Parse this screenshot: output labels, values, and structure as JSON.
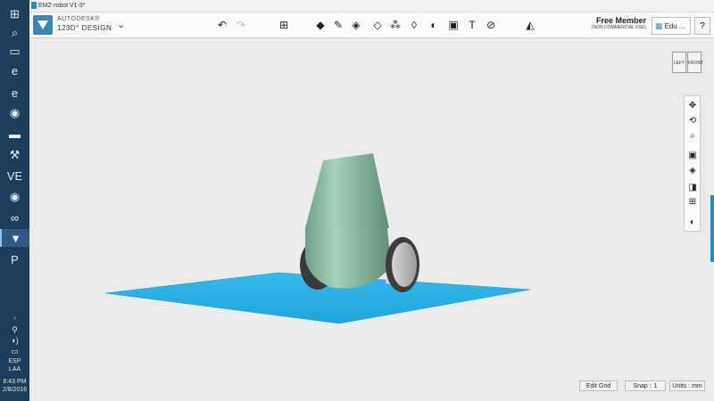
{
  "taskbar": {
    "items": [
      {
        "name": "windows-start-icon",
        "glyph": "⊞"
      },
      {
        "name": "search-icon",
        "glyph": "⌕"
      },
      {
        "name": "task-view-icon",
        "glyph": "▭"
      },
      {
        "name": "edge-icon",
        "glyph": "e"
      },
      {
        "name": "ie-icon",
        "glyph": "e"
      },
      {
        "name": "chrome-icon",
        "glyph": "◉"
      },
      {
        "name": "file-explorer-icon",
        "glyph": "▬"
      },
      {
        "name": "app-icon",
        "glyph": "⚒"
      },
      {
        "name": "ve-app-icon",
        "glyph": "VE"
      },
      {
        "name": "chrome-alt-icon",
        "glyph": "◉"
      },
      {
        "name": "visual-studio-icon",
        "glyph": "∞"
      },
      {
        "name": "123d-design-icon",
        "glyph": "▼"
      },
      {
        "name": "powerpoint-icon",
        "glyph": "P"
      }
    ],
    "tray": {
      "chevron": "›",
      "lang1": "ESP",
      "lang2": "LAA",
      "time": "8:43 PM",
      "date": "2/8/2016"
    }
  },
  "window": {
    "title": "EMZ-robot V1-3*"
  },
  "app": {
    "brand_top": "AUTODESK®",
    "brand_name": "123D° DESIGN",
    "menu_arrow": "⌄",
    "undo": "↶",
    "redo": "↷",
    "tools": [
      {
        "name": "transform-tool-icon",
        "glyph": "⊞"
      },
      {
        "name": "primitives-tool-icon",
        "glyph": "◆"
      },
      {
        "name": "sketch-tool-icon",
        "glyph": "✎"
      },
      {
        "name": "construct-tool-icon",
        "glyph": "◈"
      },
      {
        "name": "modify-tool-icon",
        "glyph": "◇"
      },
      {
        "name": "pattern-tool-icon",
        "glyph": "⁂"
      },
      {
        "name": "grouping-tool-icon",
        "glyph": "◊"
      },
      {
        "name": "combine-tool-icon",
        "glyph": "◐"
      },
      {
        "name": "snap-tool-icon",
        "glyph": "▣"
      },
      {
        "name": "text-tool-icon",
        "glyph": "T"
      },
      {
        "name": "measure-tool-icon",
        "glyph": "⊘"
      },
      {
        "name": "material-tool-icon",
        "glyph": "◭"
      }
    ],
    "member_title": "Free Member",
    "member_sub": "(NON COMMERCIAL USE)",
    "account_label": "Edu ...",
    "help_label": "?"
  },
  "viewcube": {
    "left": "LEFT",
    "front": "FRONT"
  },
  "nav_tools": [
    {
      "name": "pan-icon",
      "glyph": "✥"
    },
    {
      "name": "orbit-icon",
      "glyph": "⟲"
    },
    {
      "name": "zoom-icon",
      "glyph": "⌕"
    },
    {
      "name": "fit-view-icon",
      "glyph": "▣"
    },
    {
      "name": "view-mode-icon",
      "glyph": "◈"
    },
    {
      "name": "visibility-icon",
      "glyph": "◨"
    },
    {
      "name": "grid-settings-icon",
      "glyph": "⊞"
    },
    {
      "name": "material-view-icon",
      "glyph": "◐"
    }
  ],
  "status": {
    "edit_grid": "Edit Grid",
    "snap_label": "Snap :",
    "snap_value": "1",
    "units": "Units : mm"
  },
  "colors": {
    "grid": "#2ab1e8",
    "body": "#8fc2a6",
    "wheel": "#4a4a4a"
  }
}
